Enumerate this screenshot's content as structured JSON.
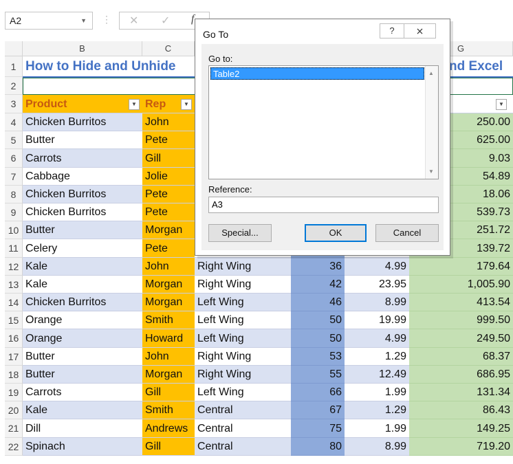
{
  "formula_bar": {
    "name_box": "A2",
    "dropdown_glyph": "▼",
    "separator_glyph": "⋮",
    "cancel_glyph": "✕",
    "enter_glyph": "✓",
    "fx_label": "f"
  },
  "columns": [
    "B",
    "C",
    "G"
  ],
  "sheet": {
    "title_left": "How to Hide and Unhide",
    "title_right": "nd Excel",
    "headers": {
      "product": "Product",
      "rep": "Rep"
    },
    "rows": [
      {
        "num": "4",
        "product": "Chicken Burritos",
        "rep": "John",
        "region": "",
        "qty": "",
        "price": "",
        "sales": "250.00"
      },
      {
        "num": "5",
        "product": "Butter",
        "rep": "Pete",
        "region": "",
        "qty": "",
        "price": "",
        "sales": "625.00"
      },
      {
        "num": "6",
        "product": "Carrots",
        "rep": "Gill",
        "region": "",
        "qty": "",
        "price": "",
        "sales": "9.03"
      },
      {
        "num": "7",
        "product": "Cabbage",
        "rep": "Jolie",
        "region": "",
        "qty": "",
        "price": "",
        "sales": "54.89"
      },
      {
        "num": "8",
        "product": "Chicken Burritos",
        "rep": "Pete",
        "region": "",
        "qty": "",
        "price": "",
        "sales": "18.06"
      },
      {
        "num": "9",
        "product": "Chicken Burritos",
        "rep": "Pete",
        "region": "",
        "qty": "",
        "price": "",
        "sales": "539.73"
      },
      {
        "num": "10",
        "product": "Butter",
        "rep": "Morgan",
        "region": "",
        "qty": "",
        "price": "",
        "sales": "251.72"
      },
      {
        "num": "11",
        "product": "Celery",
        "rep": "Pete",
        "region": "",
        "qty": "",
        "price": "",
        "sales": "139.72"
      },
      {
        "num": "12",
        "product": "Kale",
        "rep": "John",
        "region": "Right Wing",
        "qty": "36",
        "price": "4.99",
        "sales": "179.64"
      },
      {
        "num": "13",
        "product": "Kale",
        "rep": "Morgan",
        "region": "Right Wing",
        "qty": "42",
        "price": "23.95",
        "sales": "1,005.90"
      },
      {
        "num": "14",
        "product": "Chicken Burritos",
        "rep": "Morgan",
        "region": "Left Wing",
        "qty": "46",
        "price": "8.99",
        "sales": "413.54"
      },
      {
        "num": "15",
        "product": "Orange",
        "rep": "Smith",
        "region": "Left Wing",
        "qty": "50",
        "price": "19.99",
        "sales": "999.50"
      },
      {
        "num": "16",
        "product": "Orange",
        "rep": "Howard",
        "region": "Left Wing",
        "qty": "50",
        "price": "4.99",
        "sales": "249.50"
      },
      {
        "num": "17",
        "product": "Butter",
        "rep": "John",
        "region": "Right Wing",
        "qty": "53",
        "price": "1.29",
        "sales": "68.37"
      },
      {
        "num": "18",
        "product": "Butter",
        "rep": "Morgan",
        "region": "Right Wing",
        "qty": "55",
        "price": "12.49",
        "sales": "686.95"
      },
      {
        "num": "19",
        "product": "Carrots",
        "rep": "Gill",
        "region": "Left Wing",
        "qty": "66",
        "price": "1.99",
        "sales": "131.34"
      },
      {
        "num": "20",
        "product": "Kale",
        "rep": "Smith",
        "region": "Central",
        "qty": "67",
        "price": "1.29",
        "sales": "86.43"
      },
      {
        "num": "21",
        "product": "Dill",
        "rep": "Andrews",
        "region": "Central",
        "qty": "75",
        "price": "1.99",
        "sales": "149.25"
      },
      {
        "num": "22",
        "product": "Spinach",
        "rep": "Gill",
        "region": "Central",
        "qty": "80",
        "price": "8.99",
        "sales": "719.20"
      }
    ]
  },
  "dialog": {
    "title": "Go To",
    "help_glyph": "?",
    "close_glyph": "⨯",
    "goto_label": "Go to:",
    "list_items": [
      "Table2"
    ],
    "reference_label": "Reference:",
    "reference_value": "A3",
    "special_button": "Special...",
    "ok_button": "OK",
    "cancel_button": "Cancel"
  }
}
